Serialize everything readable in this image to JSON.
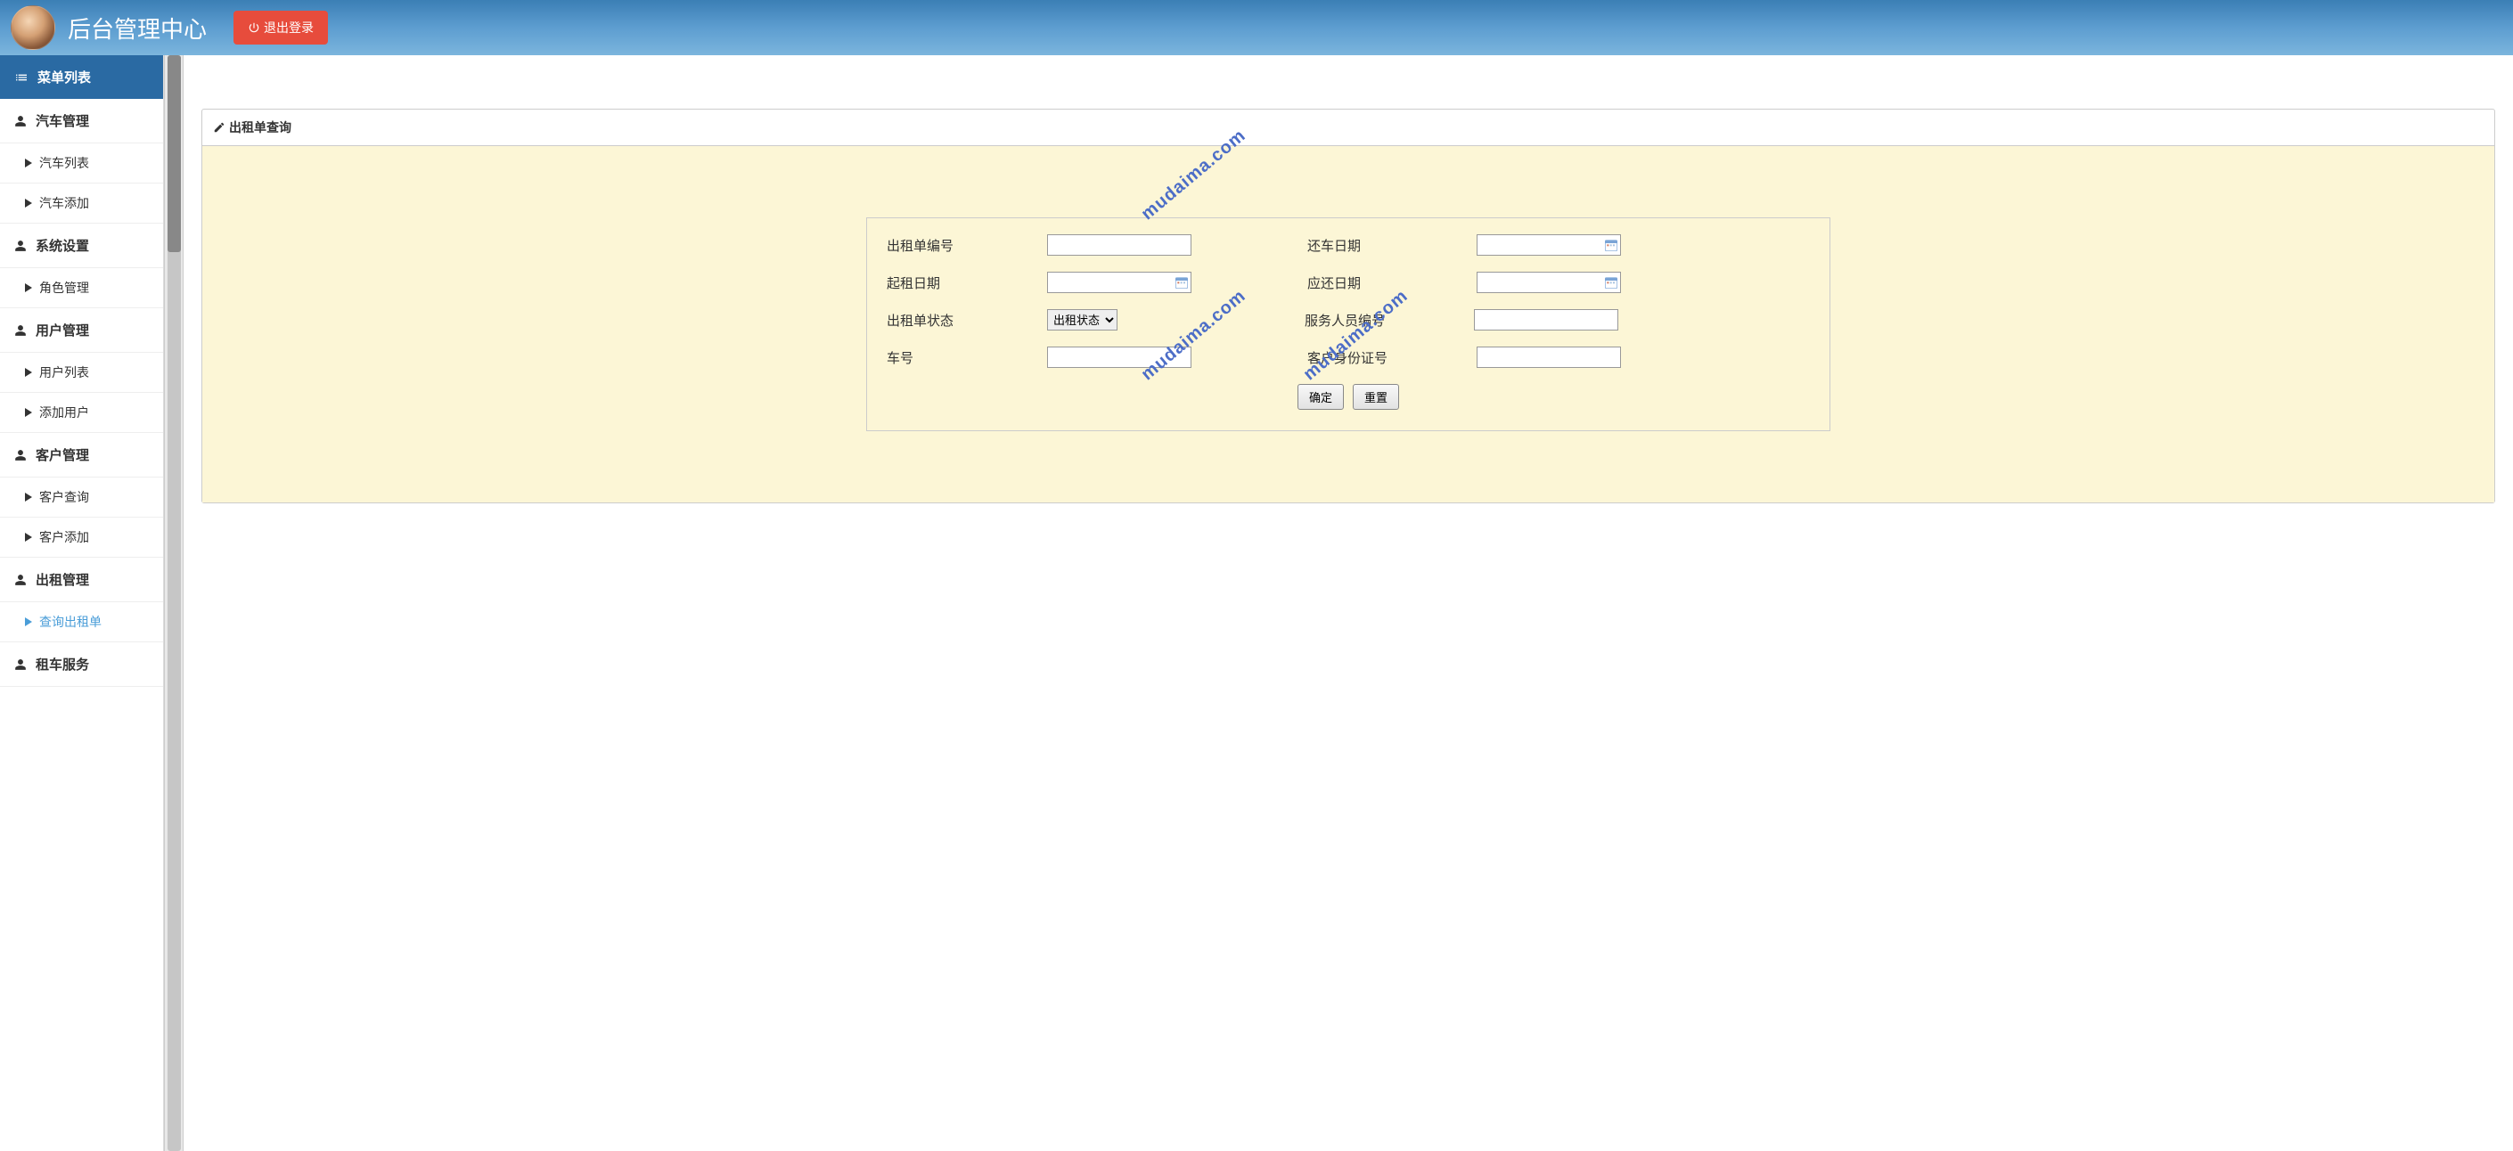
{
  "header": {
    "title": "后台管理中心",
    "logout_label": "退出登录"
  },
  "sidebar": {
    "header": "菜单列表",
    "groups": [
      {
        "label": "汽车管理",
        "items": [
          {
            "label": "汽车列表"
          },
          {
            "label": "汽车添加"
          }
        ]
      },
      {
        "label": "系统设置",
        "items": [
          {
            "label": "角色管理"
          }
        ]
      },
      {
        "label": "用户管理",
        "items": [
          {
            "label": "用户列表"
          },
          {
            "label": "添加用户"
          }
        ]
      },
      {
        "label": "客户管理",
        "items": [
          {
            "label": "客户查询"
          },
          {
            "label": "客户添加"
          }
        ]
      },
      {
        "label": "出租管理",
        "items": [
          {
            "label": "查询出租单",
            "active": true
          }
        ]
      },
      {
        "label": "租车服务",
        "items": []
      }
    ]
  },
  "panel": {
    "title": "出租单查询"
  },
  "form": {
    "labels": {
      "rental_no": "出租单编号",
      "return_date": "还车日期",
      "start_date": "起租日期",
      "due_date": "应还日期",
      "status": "出租单状态",
      "staff_no": "服务人员编号",
      "car_no": "车号",
      "customer_id": "客户身份证号"
    },
    "status_selected": "出租状态",
    "status_options": [
      "出租状态"
    ],
    "buttons": {
      "submit": "确定",
      "reset": "重置"
    }
  },
  "watermark_text": "mudaima.com"
}
